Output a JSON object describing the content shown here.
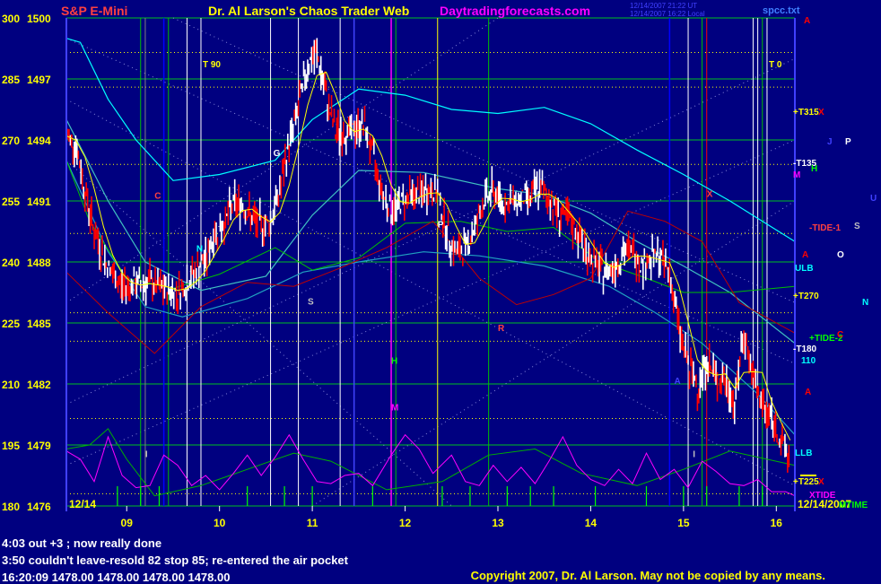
{
  "header": {
    "left_title": "S&P E-Mini",
    "center_title": "Dr. Al Larson's Chaos Trader Web",
    "site": "Daytradingforecasts.com",
    "stamp_line1": "12/14/2007 21:22 UT",
    "stamp_line2": "12/14/2007 16:22 Local",
    "file_label": "spcc.txt"
  },
  "colors": {
    "background": "#000080",
    "price_up": "#ffffff",
    "price_down": "#ff0000",
    "moving_avg": "#ffff00",
    "band_cyan": "#00ffff",
    "band_green": "#00c000",
    "band_red": "#c00000",
    "oscillator": "#ff00ff",
    "grid_white": "#ffffff",
    "grid_green": "#00ff00",
    "grid_yellow": "#ffff00",
    "title_red": "#ff4040",
    "title_yellow": "#ffff00",
    "site_magenta": "#ff00ff"
  },
  "chart_data": {
    "type": "line",
    "title": "S&P E-Mini",
    "xlabel": "",
    "ylabel": "",
    "x_ticks": [
      "09",
      "10",
      "11",
      "12",
      "13",
      "14",
      "15",
      "16"
    ],
    "xlim": [
      8.35,
      16.2
    ],
    "y_ticks_price": [
      1476,
      1479,
      1482,
      1485,
      1488,
      1491,
      1494,
      1497,
      1500
    ],
    "y_ticks_angle": [
      180,
      195,
      210,
      225,
      240,
      255,
      270,
      285,
      300
    ],
    "ylim": [
      1476,
      1500
    ],
    "date_label": "12/14",
    "date_label_right": "12/14/2007",
    "series": [
      {
        "name": "",
        "x": [
          8.35,
          8.45,
          8.55,
          8.65,
          8.75,
          8.85,
          8.95,
          9.05,
          9.15,
          9.25,
          9.35,
          9.45,
          9.55,
          9.65,
          9.75,
          9.85,
          9.95,
          10.05,
          10.15,
          10.25,
          10.35,
          10.45,
          10.55,
          10.65,
          10.75,
          10.85,
          10.95,
          11.05,
          11.15,
          11.25,
          11.35,
          11.45,
          11.55,
          11.65,
          11.75,
          11.85,
          11.95,
          12.05,
          12.15,
          12.25,
          12.35,
          12.45,
          12.55,
          12.65,
          12.75,
          12.85,
          12.95,
          13.05,
          13.15,
          13.25,
          13.35,
          13.45,
          13.55,
          13.65,
          13.75,
          13.85,
          13.95,
          14.05,
          14.15,
          14.25,
          14.35,
          14.45,
          14.55,
          14.65,
          14.75,
          14.85,
          14.95,
          15.05,
          15.15,
          15.25,
          15.35,
          15.45,
          15.55,
          15.65,
          15.75,
          15.85,
          15.95,
          16.05,
          16.15
        ],
        "values": [
          1494.2,
          1493.8,
          1491.5,
          1489.5,
          1488.2,
          1487.3,
          1486.8,
          1486.9,
          1486.9,
          1487.0,
          1486.7,
          1486.6,
          1486.5,
          1487.0,
          1487.6,
          1488.1,
          1489.4,
          1489.9,
          1490.9,
          1490.8,
          1490.1,
          1489.8,
          1490.0,
          1491.5,
          1493.8,
          1495.6,
          1497.7,
          1498.2,
          1496.1,
          1494.4,
          1494.3,
          1494.5,
          1494.8,
          1493.3,
          1491.5,
          1490.5,
          1490.9,
          1491.3,
          1491.3,
          1491.5,
          1491.4,
          1489.5,
          1488.4,
          1488.7,
          1489.7,
          1491.0,
          1491.5,
          1490.9,
          1490.9,
          1491.1,
          1491.2,
          1491.7,
          1491.1,
          1490.4,
          1490.1,
          1489.5,
          1488.5,
          1487.9,
          1487.5,
          1487.8,
          1488.4,
          1488.6,
          1487.9,
          1488.2,
          1488.2,
          1487.5,
          1484.8,
          1482.9,
          1481.9,
          1483.1,
          1482.3,
          1482.1,
          1481.0,
          1484.6,
          1482.2,
          1480.9,
          1480.3,
          1479.2,
          1478.2
        ]
      }
    ]
  },
  "right_labels": {
    "a_top": "A",
    "t315": "+T315",
    "x1": "X",
    "j": "J",
    "p": "P",
    "t135": "-T135",
    "m": "M",
    "h": "H",
    "u": "U",
    "tide1": "-TIDE-1",
    "s": "S",
    "a_mid": "A",
    "o": "O",
    "ulb": "ULB",
    "t270": "+T270",
    "n": "N",
    "tide2": "+TIDE-2",
    "c": "C",
    "t180": "-T180",
    "v110": "110",
    "a_low": "A",
    "llb": "LLB",
    "t225": "+T225",
    "x2": "X",
    "xtide": "XTIDE",
    "mtime": "MTIME",
    "t90": "T 90",
    "t0": "T 0"
  },
  "chart_markers": {
    "c": "C",
    "n": "N",
    "g": "G",
    "s": "S",
    "p": "P",
    "h": "H",
    "m": "M",
    "r": "R",
    "x": "X",
    "a": "A",
    "i1": "I",
    "i2": "I"
  },
  "notes": [
    "4:03 out +3 ; now really done",
    "3:50 couldn't leave-resold 82 stop 85; re-entered the air pocket",
    "16:20:09  1478.00 1478.00 1478.00 1478.00"
  ],
  "copyright": "Copyright 2007, Dr. Al Larson. May not be copied by any means."
}
